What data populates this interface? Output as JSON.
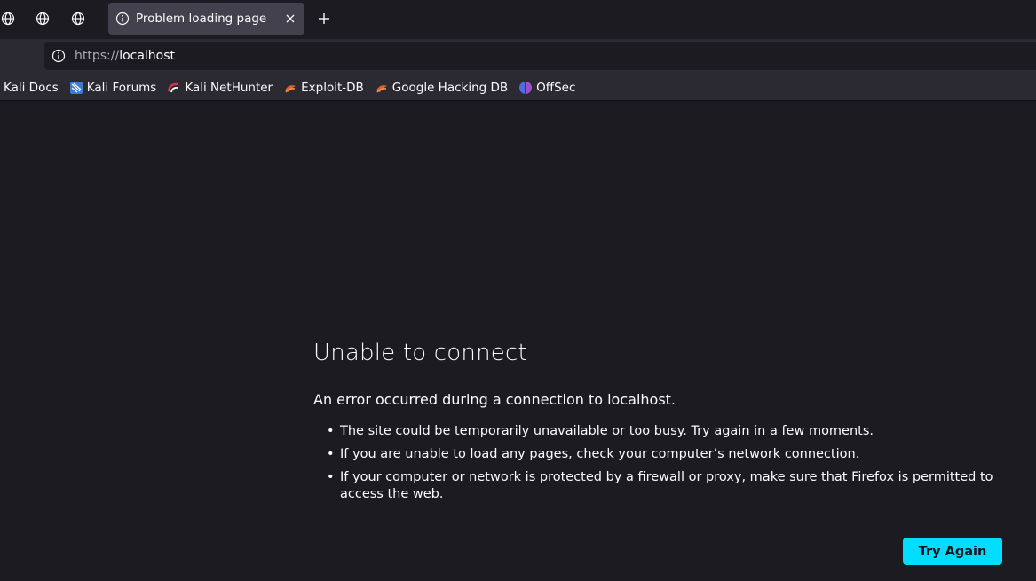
{
  "tabs": {
    "pinned": [
      {
        "icon": "globe-icon"
      },
      {
        "icon": "globe-icon"
      },
      {
        "icon": "globe-icon"
      }
    ],
    "active": {
      "icon": "info-icon",
      "title": "Problem loading page",
      "close_icon": "close-icon"
    },
    "new_tab_icon": "plus-icon"
  },
  "urlbar": {
    "icon": "info-icon",
    "scheme": "https://",
    "host": "localhost"
  },
  "bookmarks": [
    {
      "label": "Kali Docs",
      "icon": ""
    },
    {
      "label": "Kali Forums",
      "icon": "kali-dragon-icon"
    },
    {
      "label": "Kali NetHunter",
      "icon": "nethunter-icon"
    },
    {
      "label": "Exploit-DB",
      "icon": "exploit-db-icon"
    },
    {
      "label": "Google Hacking DB",
      "icon": "exploit-db-icon"
    },
    {
      "label": "OffSec",
      "icon": "offsec-icon"
    }
  ],
  "error": {
    "title": "Unable to connect",
    "description": "An error occurred during a connection to localhost.",
    "bullets": [
      "The site could be temporarily unavailable or too busy. Try again in a few moments.",
      "If you are unable to load any pages, check your computer’s network connection.",
      "If your computer or network is protected by a firewall or proxy, make sure that Firefox is permitted to access the web."
    ],
    "try_again_label": "Try Again"
  },
  "colors": {
    "background": "#1c1b22",
    "toolbar": "#2b2a33",
    "active_tab": "#42414d",
    "accent_button": "#00ddff",
    "text": "#fbfbfe"
  }
}
